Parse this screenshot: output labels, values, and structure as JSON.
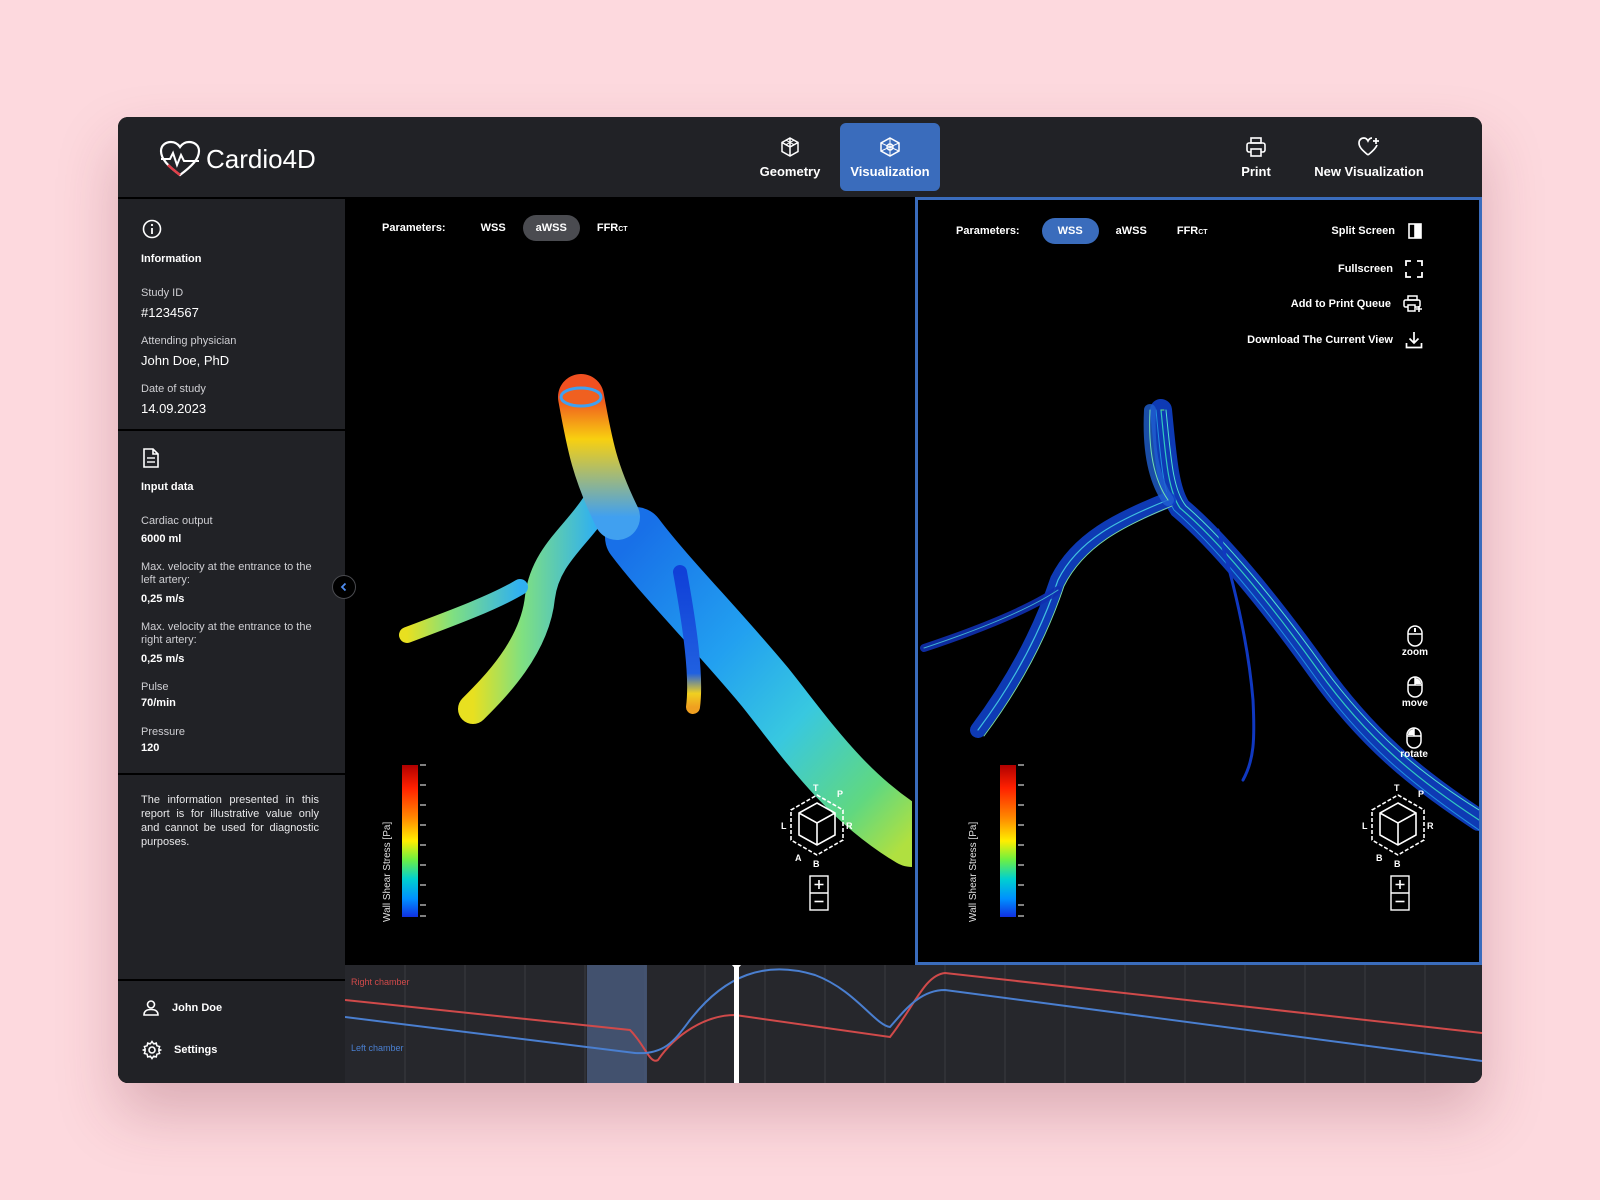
{
  "app": {
    "name": "Cardio4D",
    "brand_color": "#3a6cbc"
  },
  "header": {
    "nav": [
      {
        "label": "Geometry",
        "icon": "cube-wireframe-icon",
        "active": false
      },
      {
        "label": "Visualization",
        "icon": "molecule-icon",
        "active": true
      }
    ],
    "actions": [
      {
        "label": "Print",
        "icon": "printer-icon"
      },
      {
        "label": "New Visualization",
        "icon": "heart-plus-icon"
      }
    ]
  },
  "sidebar": {
    "information": {
      "title": "Information",
      "icon": "info-circle-icon",
      "study_id_label": "Study ID",
      "study_id": "#1234567",
      "physician_label": "Attending physician",
      "physician": "John Doe, PhD",
      "date_label": "Date of study",
      "date": "14.09.2023"
    },
    "input_data": {
      "title": "Input data",
      "icon": "document-icon",
      "cardiac_output_label": "Cardiac output",
      "cardiac_output": "6000 ml",
      "left_velocity_label": "Max. velocity at the entrance to the left artery:",
      "left_velocity": "0,25 m/s",
      "right_velocity_label": "Max. velocity at the entrance to the right artery:",
      "right_velocity": "0,25 m/s",
      "pulse_label": "Pulse",
      "pulse": "70/min",
      "pressure_label": "Pressure",
      "pressure": "120"
    },
    "disclaimer": "The information presented in this report is for illustrative value only and cannot be used for diagnostic purposes.",
    "user": {
      "name": "John Doe",
      "icon": "user-icon"
    },
    "settings": {
      "label": "Settings",
      "icon": "gear-icon"
    }
  },
  "left_view": {
    "parameters_label": "Parameters:",
    "params": [
      {
        "label": "WSS",
        "sub": "",
        "active": false
      },
      {
        "label": "aWSS",
        "sub": "",
        "active": true
      },
      {
        "label": "FFR",
        "sub": "CT",
        "active": false
      }
    ],
    "colorbar_label": "Wall Shear Stress [Pa]",
    "orientation_labels": {
      "top": "T",
      "posterior": "P",
      "left": "L",
      "right": "R",
      "anterior": "A",
      "bottom": "B"
    }
  },
  "right_view": {
    "parameters_label": "Parameters:",
    "params": [
      {
        "label": "WSS",
        "sub": "",
        "active": true
      },
      {
        "label": "aWSS",
        "sub": "",
        "active": false
      },
      {
        "label": "FFR",
        "sub": "CT",
        "active": false
      }
    ],
    "tools": [
      {
        "label": "Split Screen",
        "icon": "split-screen-icon"
      },
      {
        "label": "Fullscreen",
        "icon": "fullscreen-icon"
      },
      {
        "label": "Add to Print Queue",
        "icon": "print-add-icon"
      },
      {
        "label": "Download The Current View",
        "icon": "download-icon"
      }
    ],
    "mouse_hints": [
      {
        "label": "zoom",
        "icon": "mouse-scroll-icon"
      },
      {
        "label": "move",
        "icon": "mouse-right-icon"
      },
      {
        "label": "rotate",
        "icon": "mouse-left-icon"
      }
    ],
    "colorbar_label": "Wall Shear Stress [Pa]",
    "orientation_labels": {
      "top": "T",
      "posterior": "P",
      "left": "L",
      "right": "R",
      "anterior": "B",
      "bottom": "B"
    }
  },
  "timeline": {
    "series": [
      {
        "name": "Right chamber",
        "color": "#d04a4a"
      },
      {
        "name": "Left chamber",
        "color": "#4a7fd0"
      }
    ]
  }
}
